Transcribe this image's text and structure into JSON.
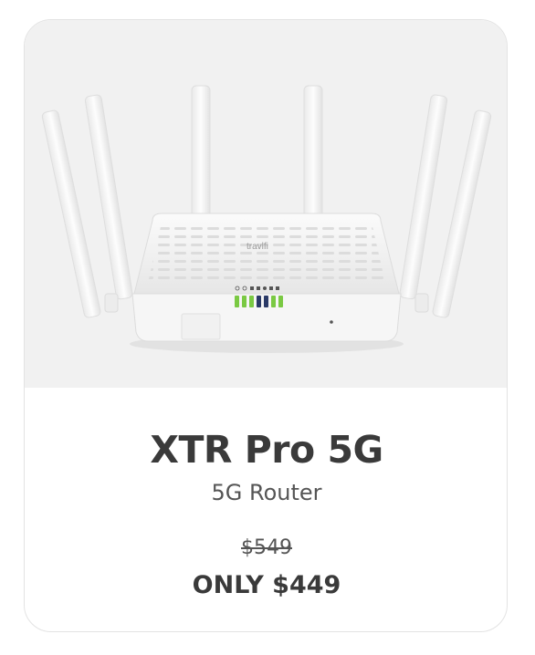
{
  "product": {
    "name": "XTR Pro 5G",
    "category": "5G Router",
    "original_price": "$549",
    "sale_price": "ONLY $449",
    "brand_logo": "travlfi",
    "image": "router-with-six-antennas"
  },
  "colors": {
    "card_border": "#e3e3e3",
    "image_background": "#f1f1f1",
    "title_text": "#3a3a3a",
    "body_text": "#555555",
    "led_green": "#7ac943",
    "led_navy": "#2b3a67"
  }
}
